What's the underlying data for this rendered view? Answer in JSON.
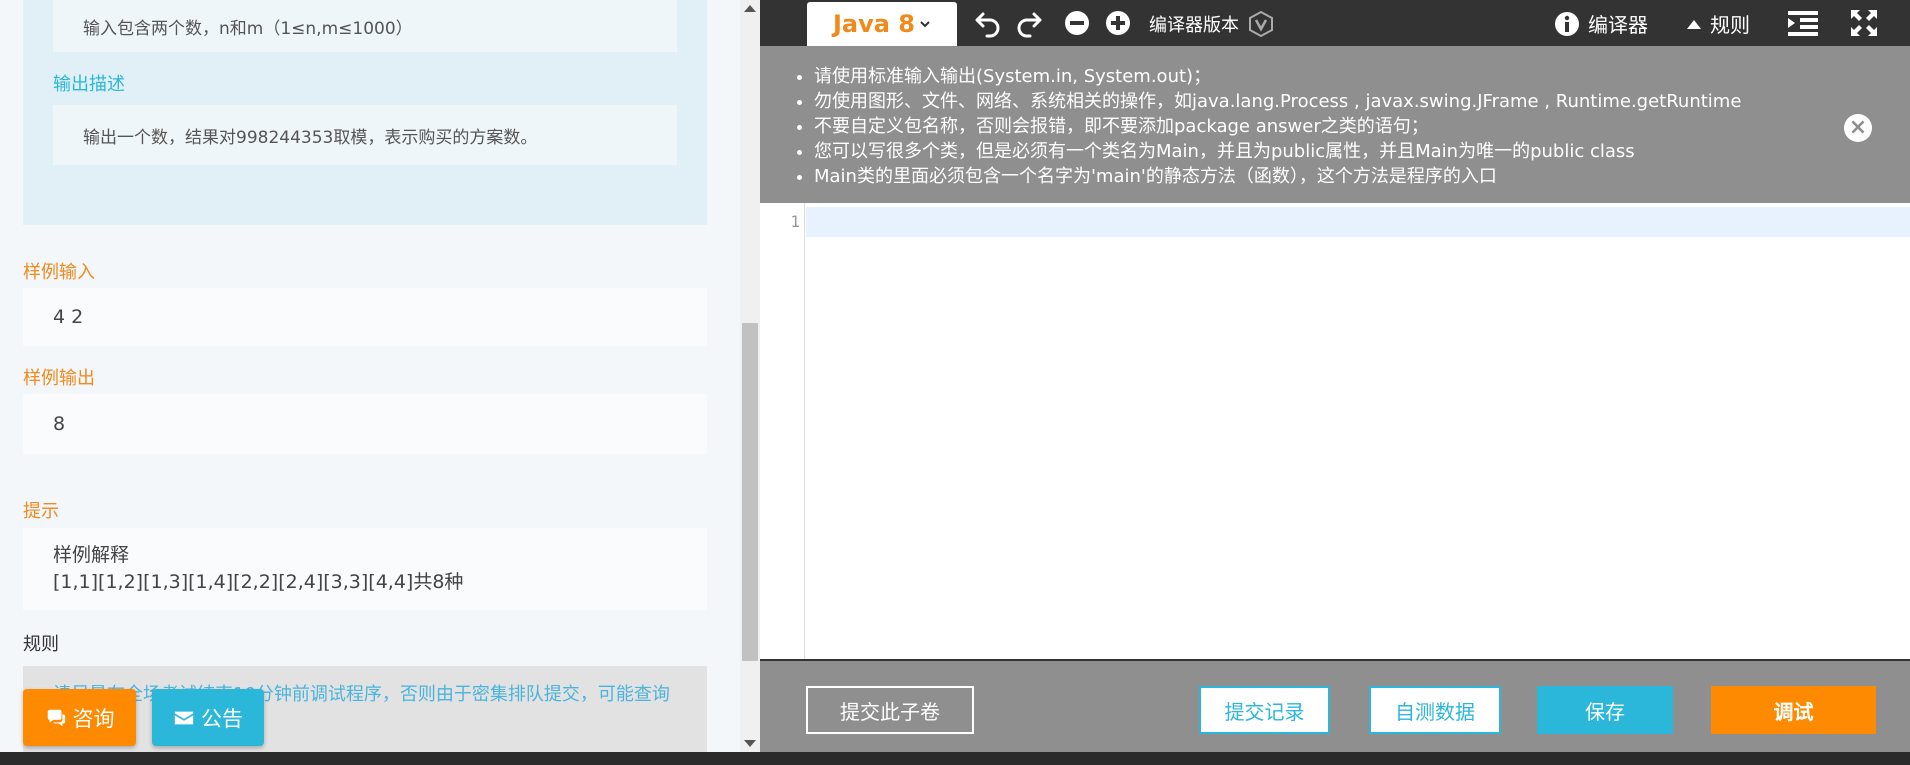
{
  "problem": {
    "input_desc_text": "输入包含两个数，n和m（1≤n,m≤1000）",
    "output_label": "输出描述",
    "output_desc_text": "输出一个数，结果对998244353取模，表示购买的方案数。",
    "sample_input_label": "样例输入",
    "sample_input_value": "4 2",
    "sample_output_label": "样例输出",
    "sample_output_value": "8",
    "hint_label": "提示",
    "hint_line1": "样例解释",
    "hint_line2": "[1,1][1,2][1,3][1,4][2,2][2,4][3,3][4,4]共8种",
    "rules_label": "规则",
    "rules_text": "请尽量在全场考试结束10分钟前调试程序，否则由于密集排队提交，可能查询"
  },
  "float_buttons": {
    "consult": "咨询",
    "notice": "公告"
  },
  "toolbar": {
    "language": "Java 8",
    "compiler_version_label": "编译器版本",
    "compiler_label": "编译器",
    "rules_label": "规则"
  },
  "notice": {
    "items": [
      "请使用标准输入输出(System.in, System.out)；",
      "勿使用图形、文件、网络、系统相关的操作，如java.lang.Process , javax.swing.JFrame , Runtime.getRuntime",
      "不要自定义包名称，否则会报错，即不要添加package answer之类的语句；",
      "您可以写很多个类，但是必须有一个类名为Main，并且为public属性，并且Main为唯一的public class",
      "Main类的里面必须包含一个名字为'main'的静态方法（函数），这个方法是程序的入口"
    ]
  },
  "editor": {
    "line_number": "1"
  },
  "bottom": {
    "submit_paper": "提交此子卷",
    "submit_history": "提交记录",
    "self_test": "自测数据",
    "save": "保存",
    "debug": "调试"
  },
  "colors": {
    "accent_orange": "#fd8a00",
    "accent_blue": "#2bb7d9",
    "toolbar_bg": "#333333",
    "notice_bg": "#8f8f8f"
  }
}
